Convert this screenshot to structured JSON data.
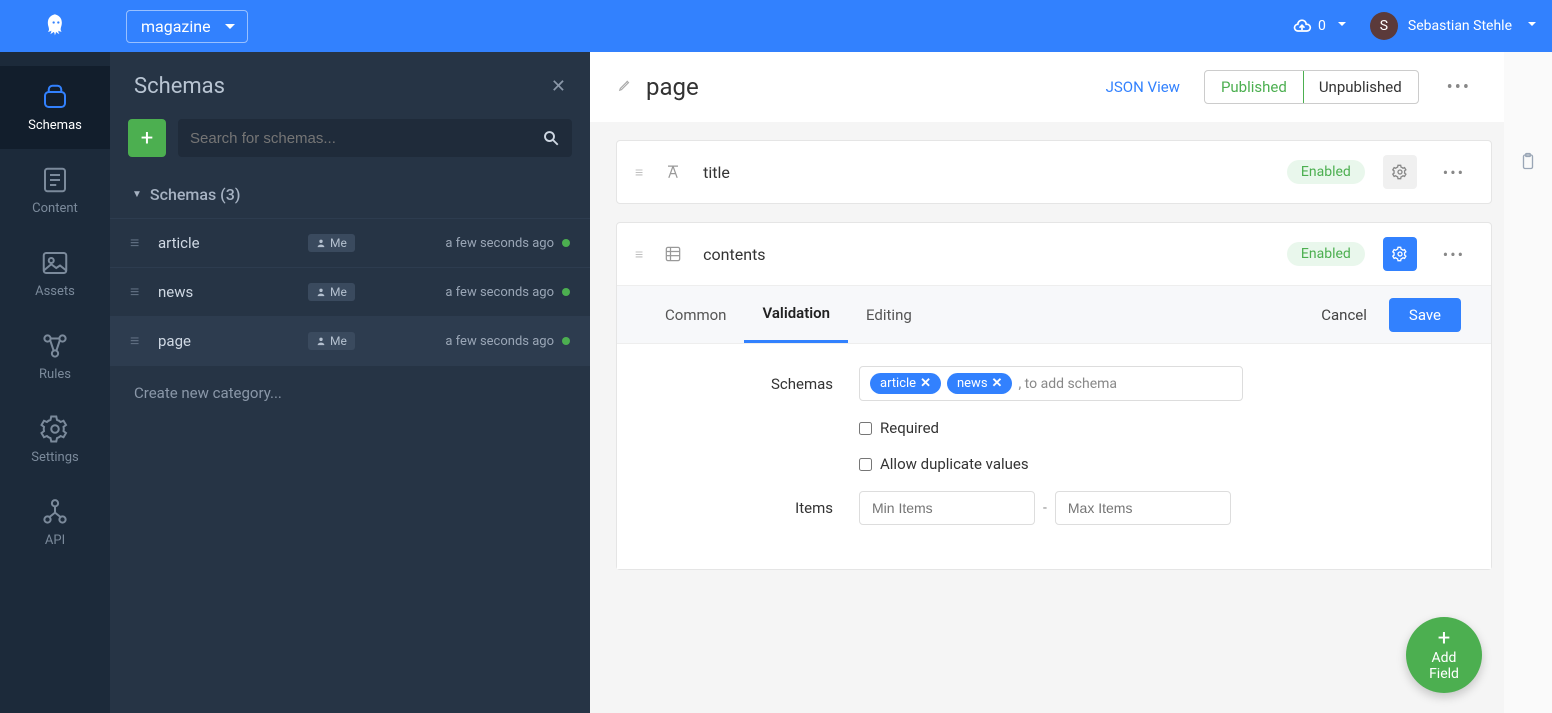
{
  "topbar": {
    "app_name": "magazine",
    "cloud_count": "0",
    "user_initial": "S",
    "user_name": "Sebastian Stehle"
  },
  "nav": {
    "schemas": "Schemas",
    "content": "Content",
    "assets": "Assets",
    "rules": "Rules",
    "settings": "Settings",
    "api": "API"
  },
  "sidebar": {
    "title": "Schemas",
    "search_placeholder": "Search for schemas...",
    "section_label": "Schemas (3)",
    "items": [
      {
        "name": "article",
        "owner": "Me",
        "time": "a few seconds ago"
      },
      {
        "name": "news",
        "owner": "Me",
        "time": "a few seconds ago"
      },
      {
        "name": "page",
        "owner": "Me",
        "time": "a few seconds ago"
      }
    ],
    "create_category": "Create new category..."
  },
  "main": {
    "title": "page",
    "json_view": "JSON View",
    "published": "Published",
    "unpublished": "Unpublished"
  },
  "fields": [
    {
      "name": "title",
      "status": "Enabled"
    },
    {
      "name": "contents",
      "status": "Enabled"
    }
  ],
  "panel": {
    "tabs": {
      "common": "Common",
      "validation": "Validation",
      "editing": "Editing"
    },
    "cancel": "Cancel",
    "save": "Save",
    "schemas_label": "Schemas",
    "schema_tags": [
      "article",
      "news"
    ],
    "schema_hint": ", to add schema",
    "required_label": "Required",
    "allow_dup_label": "Allow duplicate values",
    "items_label": "Items",
    "min_placeholder": "Min Items",
    "max_placeholder": "Max Items"
  },
  "add_field": {
    "label1": "Add",
    "label2": "Field"
  }
}
